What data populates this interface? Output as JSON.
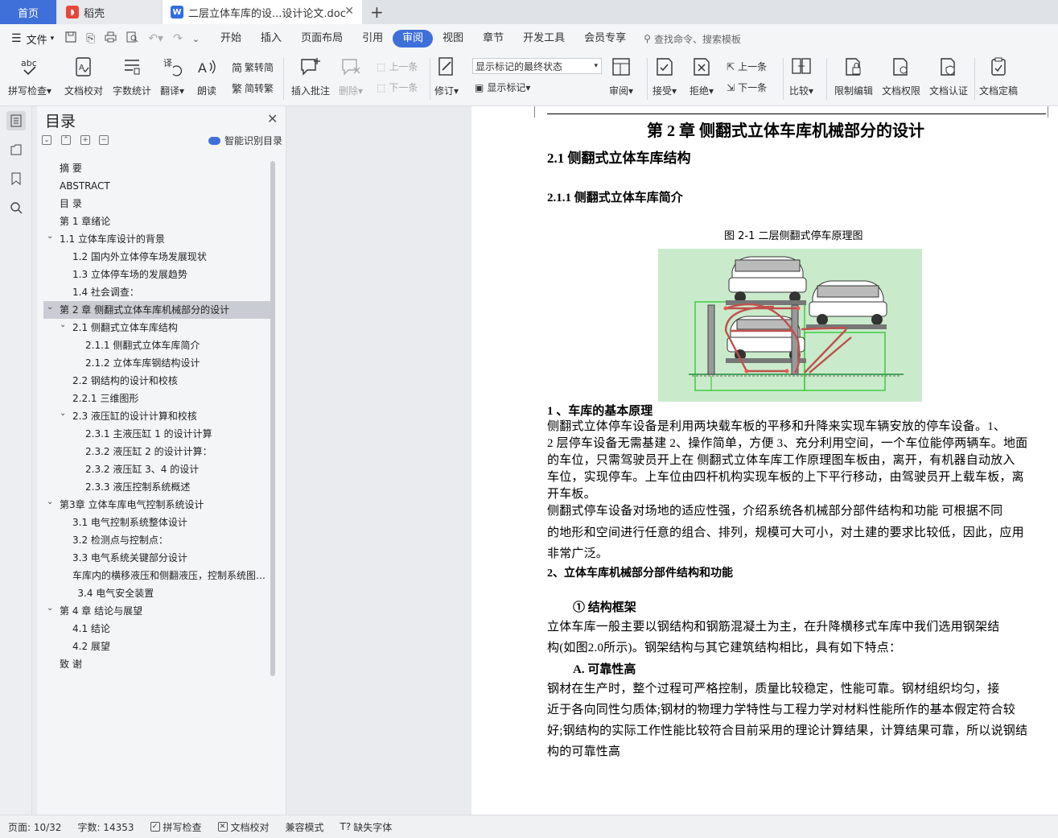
{
  "tabs": {
    "home": "首页",
    "daoke": "稻壳",
    "doc": "二层立体车库的设...设计论文.doc"
  },
  "menu": {
    "file": "文件",
    "items": [
      "开始",
      "插入",
      "页面布局",
      "引用",
      "审阅",
      "视图",
      "章节",
      "开发工具",
      "会员专享"
    ],
    "active": "审阅",
    "search": "查找命令、搜索模板"
  },
  "ribbon": {
    "spell": "拼写检查",
    "proof": "文档校对",
    "wordcount": "字数统计",
    "translate": "翻译",
    "read": "朗读",
    "trad": "繁转简",
    "simp": "简转繁",
    "insert_comment": "插入批注",
    "delete": "删除",
    "prev": "上一条",
    "next": "下一条",
    "revise": "修订",
    "markup_state": "显示标记的最终状态",
    "show_markup": "显示标记",
    "review": "审阅",
    "accept": "接受",
    "reject": "拒绝",
    "prev2": "上一条",
    "next2": "下一条",
    "compare": "比较",
    "restrict": "限制编辑",
    "permission": "文档权限",
    "certify": "文档认证",
    "finalize": "文档定稿"
  },
  "toc": {
    "title": "目录",
    "smart": "智能识别目录",
    "items": [
      {
        "label": "摘  要",
        "level": 0,
        "arrow": ""
      },
      {
        "label": "ABSTRACT",
        "level": 0,
        "arrow": ""
      },
      {
        "label": "目  录",
        "level": 0,
        "arrow": ""
      },
      {
        "label": "第 1 章绪论",
        "level": 0,
        "arrow": ""
      },
      {
        "label": "1.1  立体车库设计的背景",
        "level": 0,
        "arrow": "⌄"
      },
      {
        "label": "1.2  国内外立体停车场发展现状",
        "level": 1,
        "arrow": ""
      },
      {
        "label": "1.3  立体停车场的发展趋势",
        "level": 1,
        "arrow": ""
      },
      {
        "label": "1.4  社会调查：",
        "level": 1,
        "arrow": ""
      },
      {
        "label": "第 2 章  侧翻式立体车库机械部分的设计",
        "level": 0,
        "arrow": "⌄",
        "selected": true
      },
      {
        "label": "2.1  侧翻式立体车库结构",
        "level": 1,
        "arrow": "⌄"
      },
      {
        "label": "2.1.1  侧翻式立体车库简介",
        "level": 2,
        "arrow": ""
      },
      {
        "label": "2.1.2    立体车库钢结构设计",
        "level": 2,
        "arrow": ""
      },
      {
        "label": "2.2  钢结构的设计和校核",
        "level": 1,
        "arrow": ""
      },
      {
        "label": "2.2.1  三维图形",
        "level": 1,
        "arrow": ""
      },
      {
        "label": "2.3  液压缸的设计计算和校核",
        "level": 1,
        "arrow": "⌄"
      },
      {
        "label": "2.3.1 主液压缸 1 的设计计算",
        "level": 2,
        "arrow": ""
      },
      {
        "label": "2.3.2 液压缸 2 的设计计算：",
        "level": 2,
        "arrow": ""
      },
      {
        "label": "2.3.2  液压缸 3、4 的设计",
        "level": 2,
        "arrow": ""
      },
      {
        "label": "2.3.3  液压控制系统概述",
        "level": 2,
        "arrow": ""
      },
      {
        "label": "第3章  立体车库电气控制系统设计",
        "level": 0,
        "arrow": "⌄"
      },
      {
        "label": "3.1  电气控制系统整体设计",
        "level": 1,
        "arrow": ""
      },
      {
        "label": "3.2  检测点与控制点：",
        "level": 1,
        "arrow": ""
      },
      {
        "label": "3.3  电气系统关键部分设计",
        "level": 1,
        "arrow": ""
      },
      {
        "label": "车库内的横移液压和侧翻液压，控制系统图如下：",
        "level": 1,
        "arrow": ""
      },
      {
        "label": "3.4  电气安全装置",
        "level": 1.4,
        "arrow": ""
      },
      {
        "label": "第 4 章  结论与展望",
        "level": 0,
        "arrow": "⌄"
      },
      {
        "label": "4.1    结论",
        "level": 1,
        "arrow": ""
      },
      {
        "label": "4.2    展望",
        "level": 1,
        "arrow": ""
      },
      {
        "label": "致  谢",
        "level": 0,
        "arrow": ""
      }
    ]
  },
  "doc": {
    "chapter": "第 2 章  侧翻式立体车库机械部分的设计",
    "h21": "2.1  侧翻式立体车库结构",
    "h211": "2.1.1  侧翻式立体车库简介",
    "caption": "图 2-1 二层侧翻式停车原理图",
    "h1": "1  、车库的基本原理",
    "p1": [
      "      侧翻式立体停车设备是利用两块载车板的平移和升降来实现车辆安放的停车设备。1、",
      "2 层停车设备无需基建 2、操作简单，方便 3、充分利用空间，一个车位能停两辆车。地面",
      "的车位，只需驾驶员开上在 侧翻式立体车库工作原理图车板由，离开，有机器自动放入",
      "车位，实现停车。上车位由四杆机构实现车板的上下平行移动，由驾驶员开上载车板，离",
      "开车板。"
    ],
    "p2": [
      "      侧翻式停车设备对场地的适应性强，介绍系统各机械部分部件结构和功能  可根据不同",
      "的地形和空间进行任意的组合、排列，规模可大可小，对土建的要求比较低，因此，应用",
      "非常广泛。"
    ],
    "h2": "2、立体车库机械部分部件结构和功能",
    "h_frame": "①  结构框架",
    "p3": [
      "      立体车库一般主要以钢结构和钢筋混凝土为主，在升降横移式车库中我们选用钢架结",
      "构(如图2.0所示)。钢架结构与其它建筑结构相比，具有如下特点："
    ],
    "hA": "A.  可靠性高",
    "p4": [
      "      钢材在生产时，整个过程可严格控制，质量比较稳定，性能可靠。钢材组织均匀，接",
      "近于各向同性匀质体;钢材的物理力学特性与工程力学对材料性能所作的基本假定符合较",
      "好;钢结构的实际工作性能比较符合目前采用的理论计算结果，计算结果可靠，所以说钢结",
      "构的可靠性高"
    ]
  },
  "status": {
    "page": "页面: 10/32",
    "words": "字数: 14353",
    "spell": "拼写检查",
    "proof": "文档校对",
    "compat": "兼容模式",
    "missing_font": "缺失字体"
  },
  "colors": {
    "accent": "#3f6fd8",
    "figure_bg": "#c9ebcb"
  }
}
